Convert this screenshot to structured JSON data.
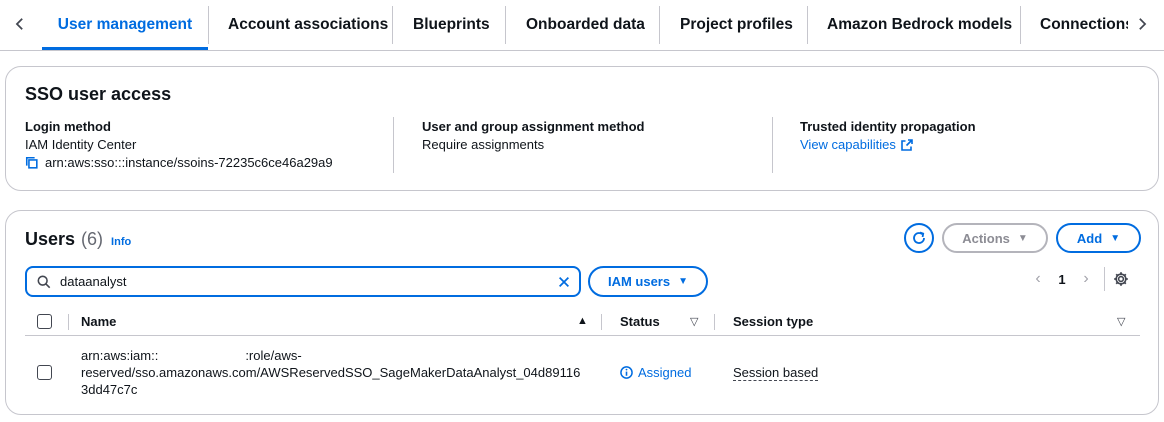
{
  "tabs": [
    {
      "label": "User management",
      "active": true
    },
    {
      "label": "Account associations",
      "active": false
    },
    {
      "label": "Blueprints",
      "active": false
    },
    {
      "label": "Onboarded data",
      "active": false
    },
    {
      "label": "Project profiles",
      "active": false
    },
    {
      "label": "Amazon Bedrock models",
      "active": false
    },
    {
      "label": "Connections",
      "active": false
    }
  ],
  "sso": {
    "title": "SSO user access",
    "login_method_label": "Login method",
    "login_method_value": "IAM Identity Center",
    "instance_arn": "arn:aws:sso:::instance/ssoins-72235c6ce46a29a9",
    "assignment_label": "User and group assignment method",
    "assignment_value": "Require assignments",
    "propagation_label": "Trusted identity propagation",
    "propagation_link": "View capabilities"
  },
  "users": {
    "title": "Users",
    "count": "(6)",
    "info": "Info",
    "actions_label": "Actions",
    "add_label": "Add",
    "search_value": "dataanalyst",
    "filter_label": "IAM users",
    "page": "1",
    "columns": {
      "name": "Name",
      "status": "Status",
      "session_type": "Session type"
    },
    "rows": [
      {
        "name_line1_a": "arn:aws:iam::",
        "name_line1_b": ":role/aws-",
        "name_line2": "reserved/sso.amazonaws.com/AWSReservedSSO_SageMakerDataAnalyst_04d89116",
        "name_line3": "3dd47c7c",
        "status": "Assigned",
        "session_type": "Session based"
      }
    ]
  },
  "colors": {
    "accent": "#006ce0",
    "border": "#c6c6cd",
    "disabled": "#8c8c94"
  }
}
